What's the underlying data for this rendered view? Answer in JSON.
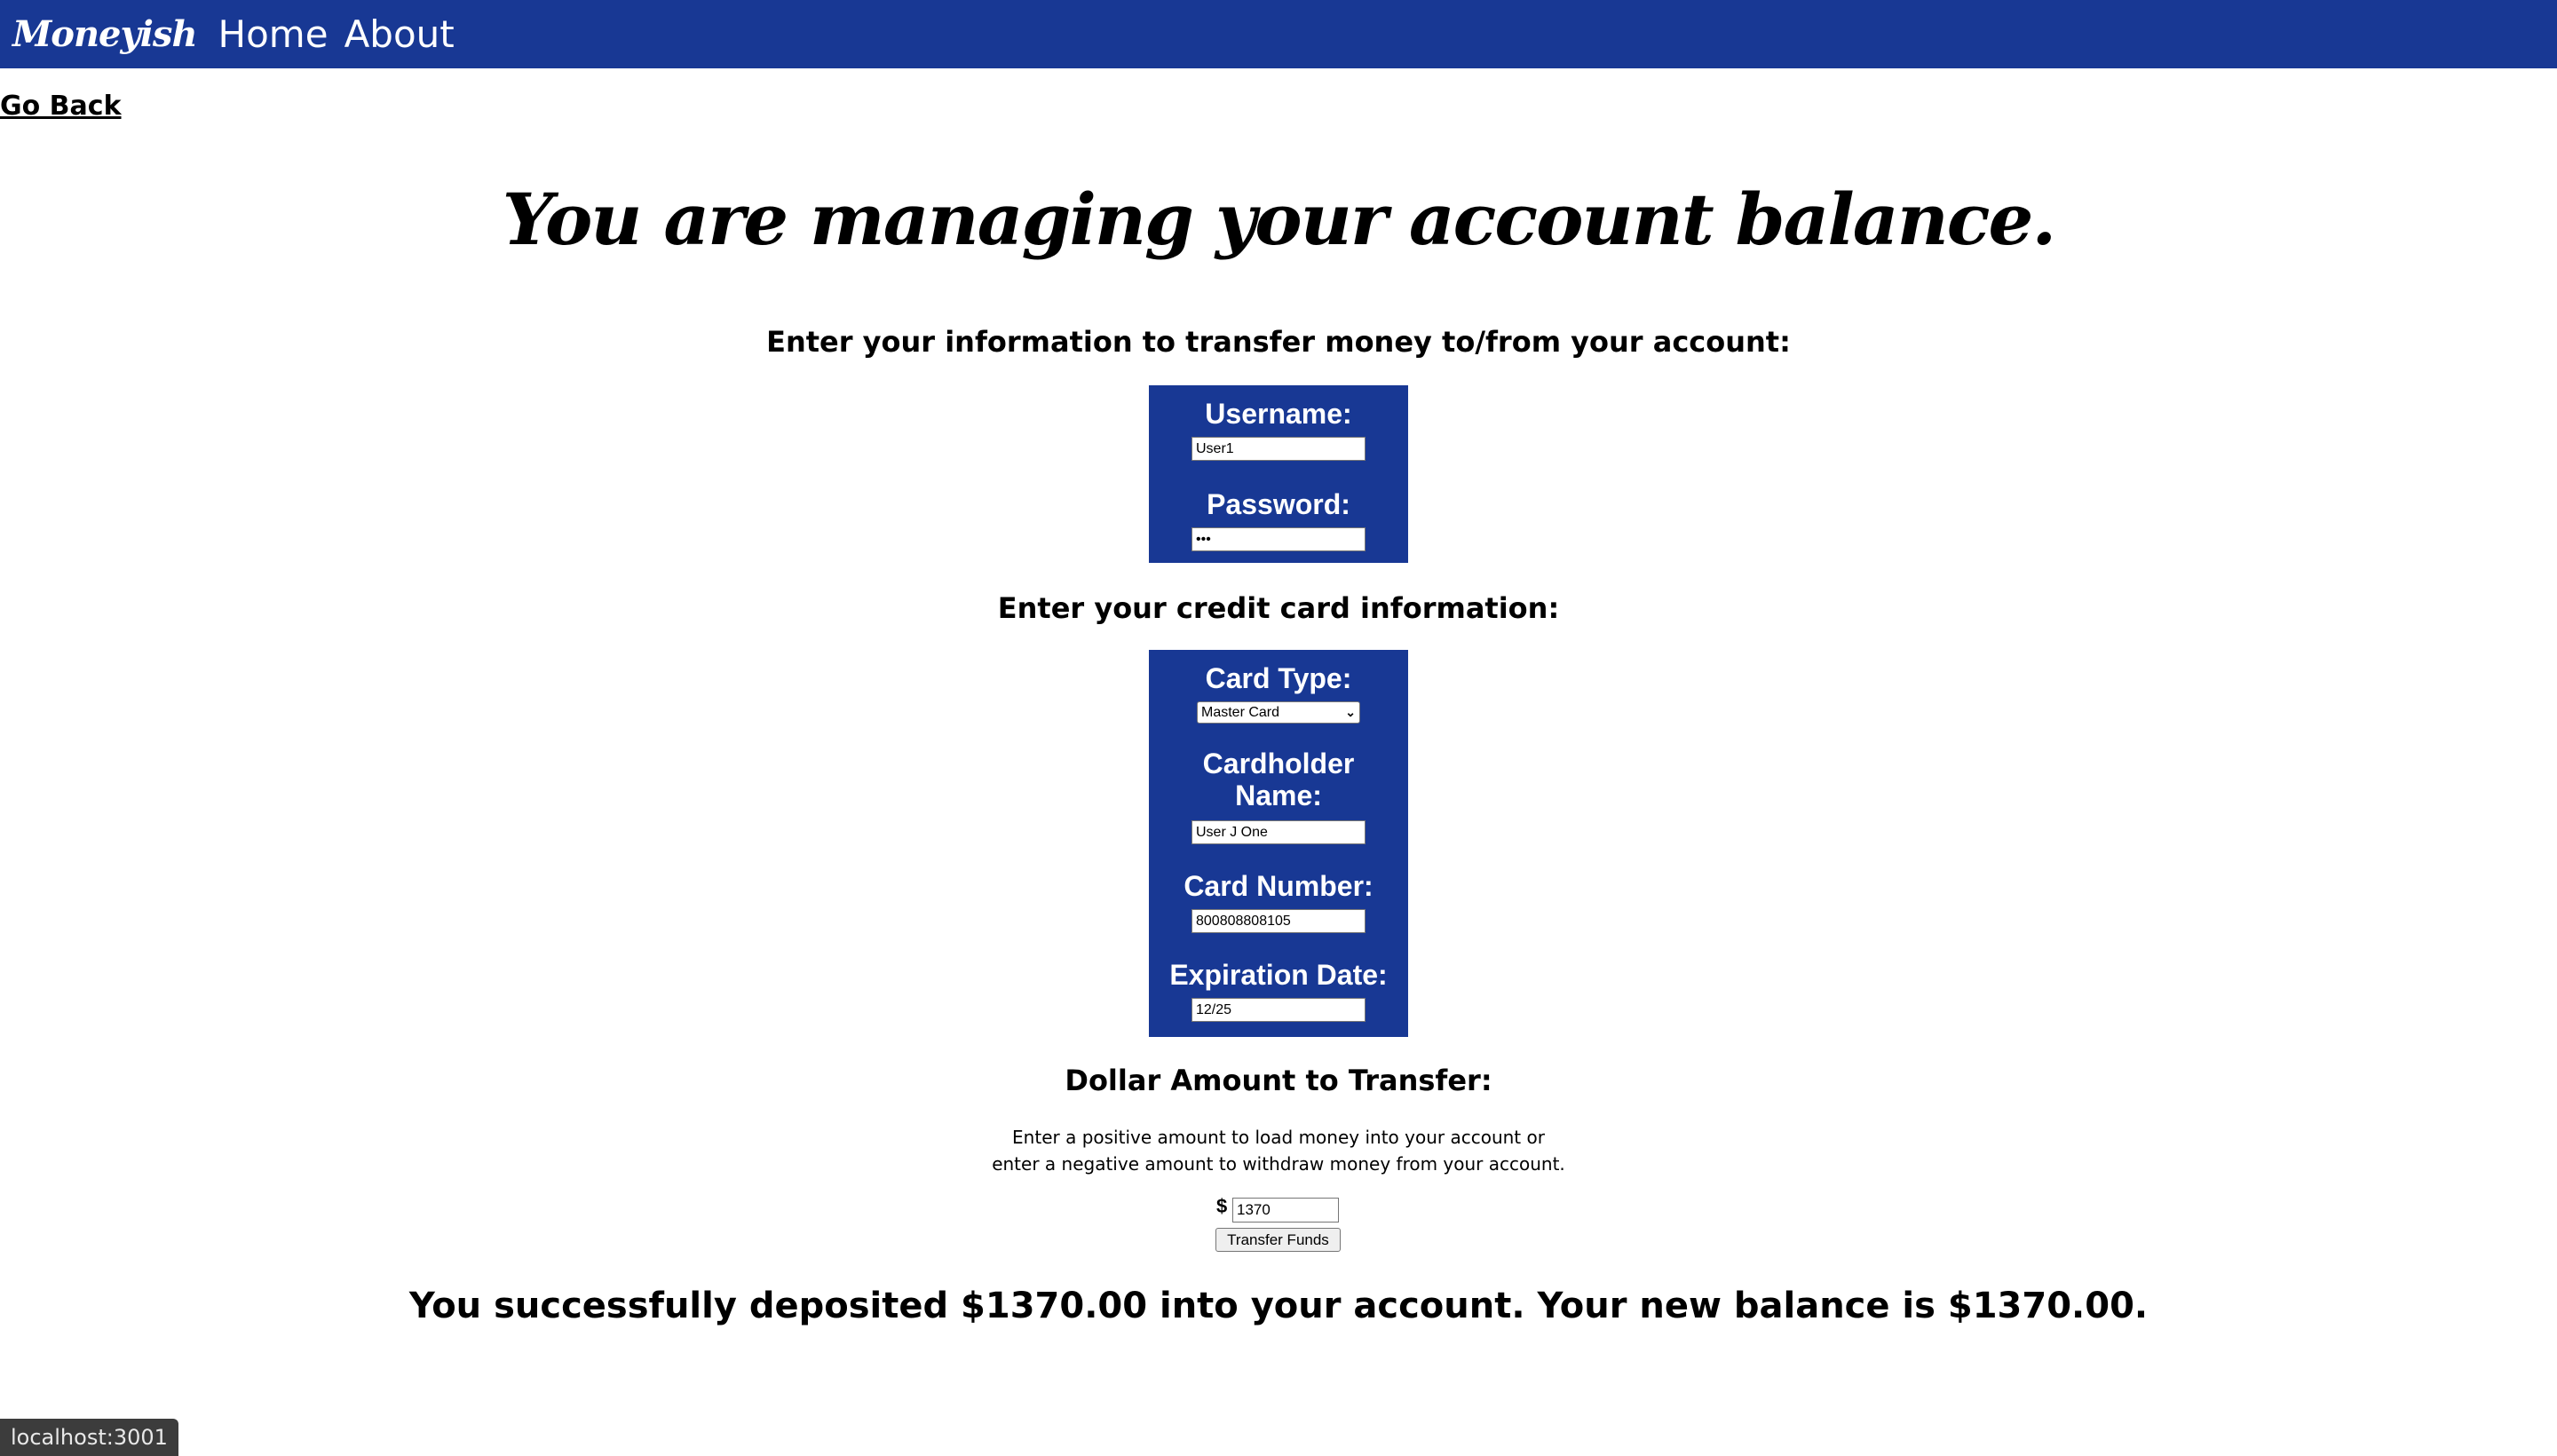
{
  "nav": {
    "brand": "Moneyish",
    "links": [
      "Home",
      "About"
    ]
  },
  "go_back": "Go Back",
  "title": "You are managing your account balance.",
  "account_section": {
    "heading": "Enter your information to transfer money to/from your account:",
    "username_label": "Username:",
    "username_value": "User1",
    "password_label": "Password:",
    "password_value": "•••"
  },
  "card_section": {
    "heading": "Enter your credit card information:",
    "card_type_label": "Card Type:",
    "card_type_value": "Master Card",
    "cardholder_label": "Cardholder Name:",
    "cardholder_value": "User J One",
    "card_number_label": "Card Number:",
    "card_number_value": "800808808105",
    "expiration_label": "Expiration Date:",
    "expiration_value": "12/25"
  },
  "transfer": {
    "heading": "Dollar Amount to Transfer:",
    "note_line1": "Enter a positive amount to load money into your account or",
    "note_line2": "enter a negative amount to withdraw money from your account.",
    "currency_symbol": "$",
    "amount_value": "1370",
    "button_label": "Transfer Funds"
  },
  "result_message": "You successfully deposited $1370.00 into your account. Your new balance is $1370.00.",
  "status_url": "localhost:3001",
  "colors": {
    "navbar": "#183894",
    "form_box": "#183894"
  }
}
